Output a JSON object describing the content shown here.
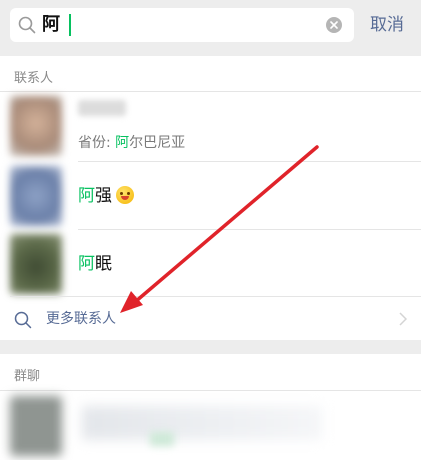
{
  "search": {
    "query": "阿",
    "cancel_label": "取消"
  },
  "contacts": {
    "header": "联系人",
    "items": [
      {
        "name_hidden": true,
        "meta_prefix": "省份: ",
        "meta_highlight": "阿",
        "meta_rest": "尔巴尼亚"
      },
      {
        "name_highlight": "阿",
        "name_rest": "强",
        "emoji": "smiling-face-icon"
      },
      {
        "name_highlight": "阿",
        "name_rest": "眠"
      }
    ],
    "more_label": "更多联系人"
  },
  "groups": {
    "header": "群聊"
  },
  "colors": {
    "highlight": "#07c160",
    "link": "#576b95",
    "annotation_arrow": "#e0232a",
    "background": "#ededed"
  }
}
